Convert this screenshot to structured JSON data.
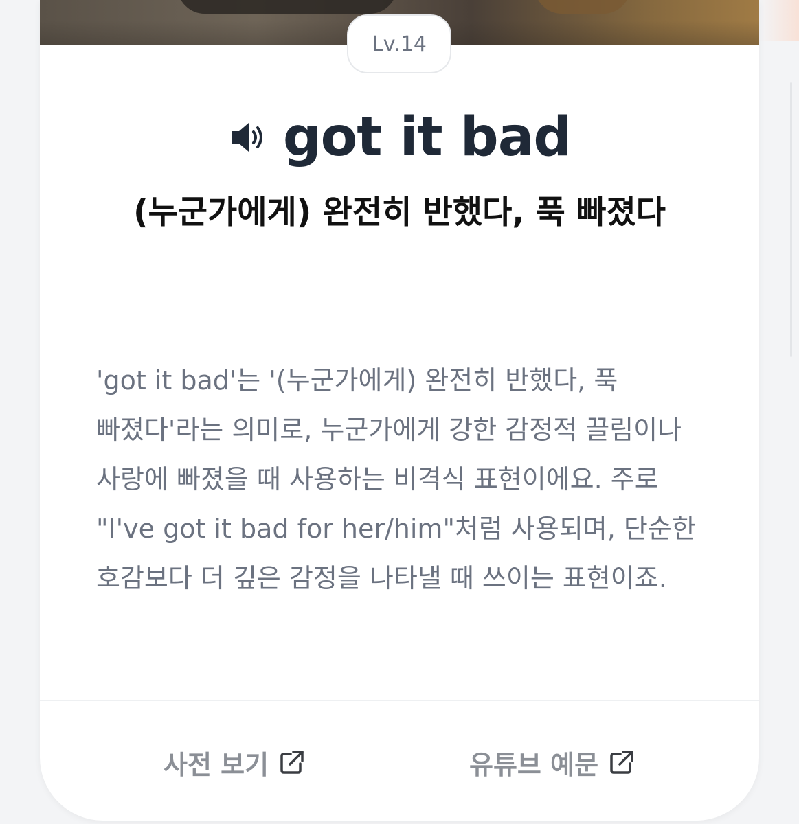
{
  "level_badge": "Lv.14",
  "word": "got it bad",
  "meaning": "(누군가에게) 완전히 반했다, 푹 빠졌다",
  "description": "'got it bad'는 '(누군가에게) 완전히 반했다, 푹 빠졌다'라는 의미로, 누군가에게 강한 감정적 끌림이나 사랑에 빠졌을 때 사용하는 비격식 표현이에요. 주로 \"I've got it bad for her/him\"처럼 사용되며, 단순한 호감보다 더 깊은 감정을 나타낼 때 쓰이는 표현이죠.",
  "links": {
    "dictionary_label": "사전 보기",
    "youtube_label": "유튜브 예문"
  },
  "icons": {
    "speaker": "speaker-icon",
    "external_link": "external-link-icon"
  },
  "colors": {
    "word": "#1f2937",
    "body_text": "#6b7280",
    "link_text": "#8b8f96",
    "card_bg": "#ffffff",
    "page_bg": "#f3f4f6"
  }
}
